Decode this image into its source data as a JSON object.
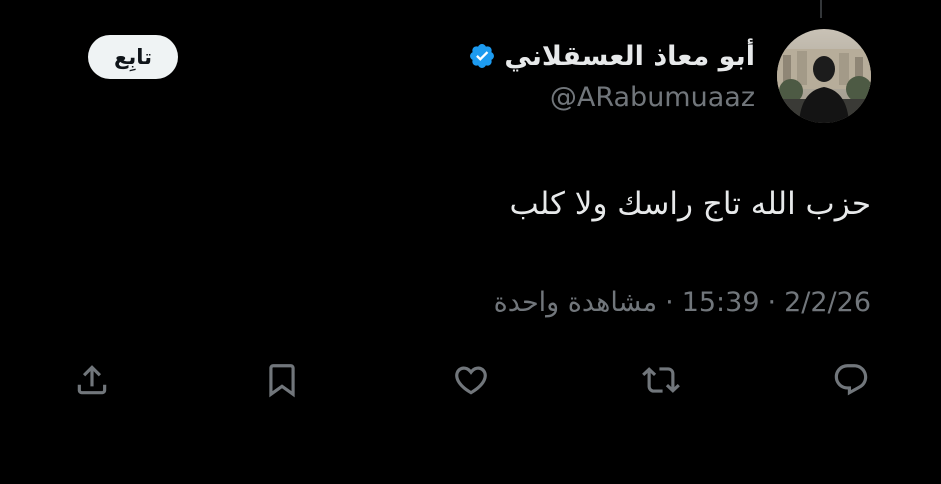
{
  "tweet": {
    "display_name": "أبو معاذ العسقلاني",
    "handle": "@ARabumuaaz",
    "follow_label": "تابِع",
    "text": "حزب الله تاج راسك ولا كلب",
    "date": "2/2/26",
    "time": "15:39",
    "separator": "·",
    "views": "مشاهدة واحدة"
  },
  "icons": {
    "verified": "verified-badge-icon",
    "reply": "reply-icon",
    "retweet": "retweet-icon",
    "like": "heart-icon",
    "bookmark": "bookmark-icon",
    "share": "share-icon"
  },
  "colors": {
    "background": "#000000",
    "primary_text": "#e7e9ea",
    "secondary_text": "#71767b",
    "verified_blue": "#1d9bf0",
    "follow_button_bg": "#eff3f4"
  }
}
